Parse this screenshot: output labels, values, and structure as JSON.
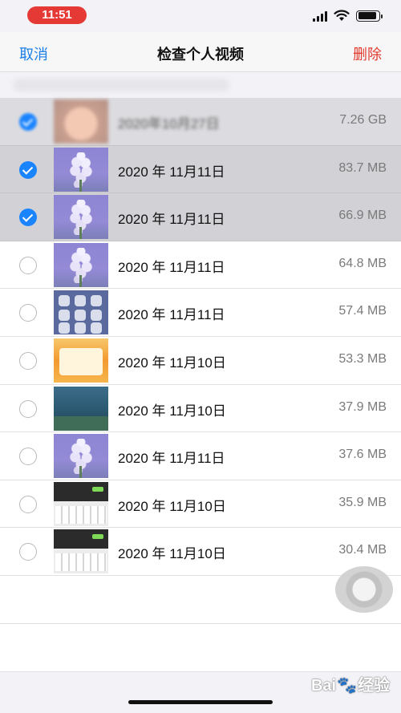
{
  "status_bar": {
    "time": "11:51",
    "battery_level": 0.9,
    "icons": [
      "cellular-signal-icon",
      "wifi-icon",
      "battery-icon"
    ]
  },
  "nav": {
    "cancel_label": "取消",
    "title": "检查个人视频",
    "delete_label": "删除"
  },
  "videos": [
    {
      "date": "2020年10月27日",
      "size": "7.26 GB",
      "selected": true,
      "thumbnail": "face"
    },
    {
      "date": "2020 年 11月11日",
      "size": "83.7 MB",
      "selected": true,
      "thumbnail": "flower"
    },
    {
      "date": "2020 年 11月11日",
      "size": "66.9 MB",
      "selected": true,
      "thumbnail": "flower"
    },
    {
      "date": "2020 年 11月11日",
      "size": "64.8 MB",
      "selected": false,
      "thumbnail": "flower"
    },
    {
      "date": "2020 年 11月11日",
      "size": "57.4 MB",
      "selected": false,
      "thumbnail": "controls"
    },
    {
      "date": "2020 年 11月10日",
      "size": "53.3 MB",
      "selected": false,
      "thumbnail": "game"
    },
    {
      "date": "2020 年 11月10日",
      "size": "37.9 MB",
      "selected": false,
      "thumbnail": "scene"
    },
    {
      "date": "2020 年 11月11日",
      "size": "37.6 MB",
      "selected": false,
      "thumbnail": "flower"
    },
    {
      "date": "2020 年 11月10日",
      "size": "35.9 MB",
      "selected": false,
      "thumbnail": "chat"
    },
    {
      "date": "2020 年 11月10日",
      "size": "30.4 MB",
      "selected": false,
      "thumbnail": "chat"
    }
  ],
  "watermark": {
    "brand_left": "Bai",
    "brand_right": "经验"
  },
  "colors": {
    "accent": "#1a84ff",
    "link": "#1a7ee6",
    "destructive": "#e23a2e",
    "status_pill": "#e53935"
  }
}
